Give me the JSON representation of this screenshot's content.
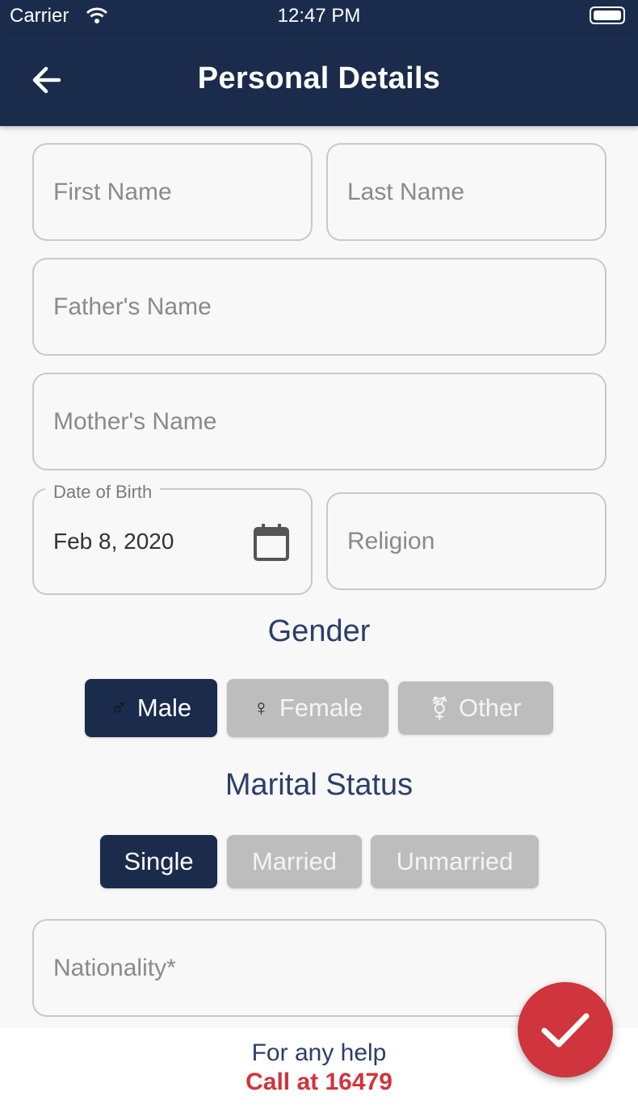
{
  "status_bar": {
    "carrier": "Carrier",
    "time": "12:47 PM"
  },
  "app_bar": {
    "title": "Personal Details",
    "back_icon": "arrow-left-icon"
  },
  "form": {
    "first_name": {
      "placeholder": "First Name",
      "value": ""
    },
    "last_name": {
      "placeholder": "Last Name",
      "value": ""
    },
    "father_name": {
      "placeholder": "Father's Name",
      "value": ""
    },
    "mother_name": {
      "placeholder": "Mother's Name",
      "value": ""
    },
    "date_of_birth": {
      "label": "Date of Birth",
      "value": "Feb 8, 2020",
      "icon": "calendar-icon"
    },
    "religion": {
      "placeholder": "Religion",
      "value": ""
    },
    "nationality": {
      "placeholder": "Nationality*",
      "value": ""
    }
  },
  "gender": {
    "title": "Gender",
    "options": [
      {
        "label": "Male",
        "symbol": "♂",
        "selected": true
      },
      {
        "label": "Female",
        "symbol": "♀",
        "selected": false
      },
      {
        "label": "Other",
        "symbol": "⚧",
        "selected": false
      }
    ]
  },
  "marital_status": {
    "title": "Marital Status",
    "options": [
      {
        "label": "Single",
        "selected": true
      },
      {
        "label": "Married",
        "selected": false
      },
      {
        "label": "Unmarried",
        "selected": false
      }
    ]
  },
  "footer": {
    "help_text": "For any help",
    "call_text": "Call at 16479"
  },
  "fab": {
    "icon": "check-icon"
  },
  "colors": {
    "primary": "#1a2b4c",
    "accent": "#d0343c",
    "chip_inactive": "#bdbdbd"
  }
}
